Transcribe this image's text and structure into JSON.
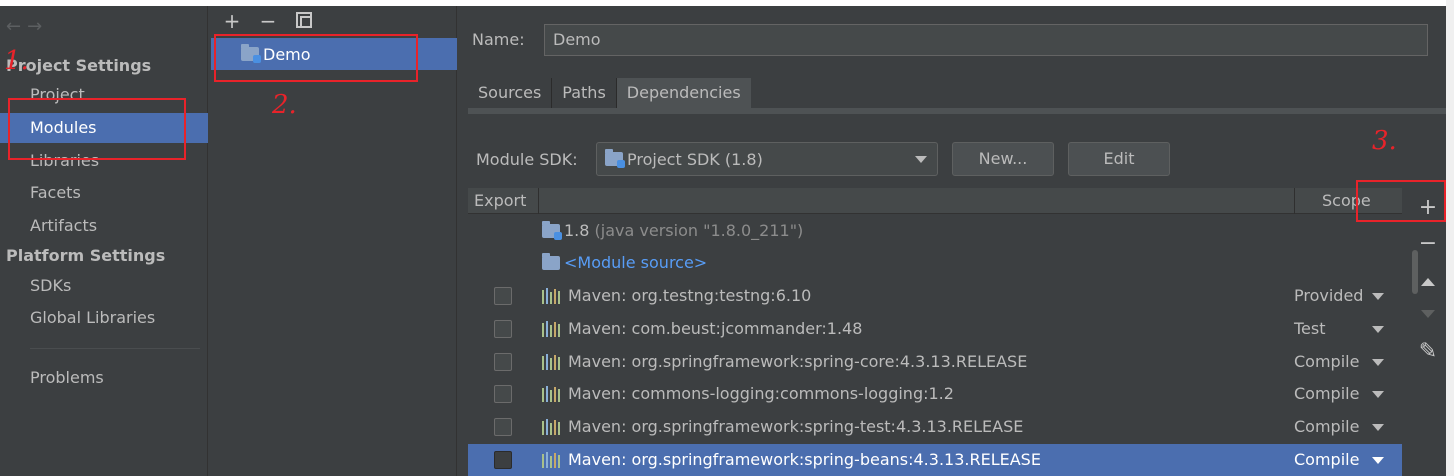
{
  "nav": {
    "back_glyph": "←",
    "forward_glyph": "→"
  },
  "sidebar": {
    "project_settings_label": "Project Settings",
    "project_items": [
      {
        "label": "Project"
      },
      {
        "label": "Modules"
      },
      {
        "label": "Libraries"
      },
      {
        "label": "Facets"
      },
      {
        "label": "Artifacts"
      }
    ],
    "platform_settings_label": "Platform Settings",
    "platform_items": [
      {
        "label": "SDKs"
      },
      {
        "label": "Global Libraries"
      }
    ],
    "problems_label": "Problems"
  },
  "modules": {
    "toolbar": {
      "add": "+",
      "remove": "−"
    },
    "items": [
      {
        "label": "Demo"
      }
    ]
  },
  "module_detail": {
    "name_label": "Name:",
    "name_value": "Demo",
    "tabs": [
      {
        "label": "Sources"
      },
      {
        "label": "Paths"
      },
      {
        "label": "Dependencies"
      }
    ],
    "sdk_label": "Module SDK:",
    "sdk_value": "Project SDK (1.8)",
    "new_button": "New...",
    "edit_button": "Edit"
  },
  "dependencies": {
    "columns": {
      "export": "Export",
      "scope": "Scope"
    },
    "jdk": {
      "name": "1.8",
      "detail": "(java version \"1.8.0_211\")"
    },
    "module_source": "<Module source>",
    "rows": [
      {
        "name": "Maven: org.testng:testng:6.10",
        "scope": "Provided"
      },
      {
        "name": "Maven: com.beust:jcommander:1.48",
        "scope": "Test"
      },
      {
        "name": "Maven: org.springframework:spring-core:4.3.13.RELEASE",
        "scope": "Compile"
      },
      {
        "name": "Maven: commons-logging:commons-logging:1.2",
        "scope": "Compile"
      },
      {
        "name": "Maven: org.springframework:spring-test:4.3.13.RELEASE",
        "scope": "Compile"
      },
      {
        "name": "Maven: org.springframework:spring-beans:4.3.13.RELEASE",
        "scope": "Compile"
      }
    ],
    "toolbar": {
      "add": "+",
      "remove": "−",
      "edit_glyph": "✎"
    }
  },
  "annotations": [
    {
      "mark": "1."
    },
    {
      "mark": "2."
    },
    {
      "mark": "3."
    }
  ],
  "colors": {
    "selection": "#4b6eaf",
    "background": "#3c3f41",
    "link": "#589df6",
    "annotation": "#e8232a"
  }
}
